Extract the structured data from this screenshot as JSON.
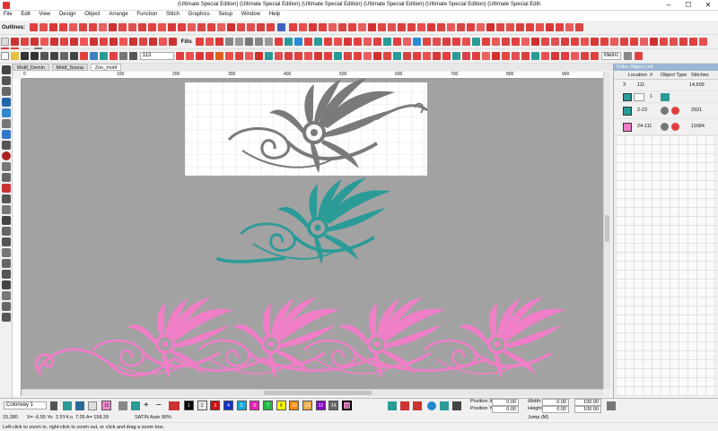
{
  "window": {
    "title": "(Ultimate Special Edition) (Ultimate Special Edition) (Ultimate Special Edition) (Ultimate Special Edition) (Ultimate Special Edition) (Ultimate Special Editi",
    "minimize": "–",
    "maximize": "☐",
    "close": "✕"
  },
  "menu": [
    "File",
    "Edit",
    "View",
    "Design",
    "Object",
    "Arrange",
    "Function",
    "Stitch",
    "Graphics",
    "Setup",
    "Window",
    "Help"
  ],
  "toolbar1": {
    "outlines_label": "Outlines:",
    "fills_label": "Fills",
    "threed_label": "3D"
  },
  "toolbar3": {
    "zoom_value": "113",
    "units_value": "Metric"
  },
  "tabs": [
    "Motif_Demin",
    "Motif_Sosna",
    "Zon_motif"
  ],
  "ruler": {
    "ticks": [
      "0",
      "100",
      "200",
      "300",
      "400",
      "500",
      "600",
      "700",
      "800",
      "900",
      "1000"
    ]
  },
  "panel": {
    "title": "Color Object List",
    "col_location": "Location",
    "col_num": "#",
    "col_object_type": "Object Type",
    "col_stitches": "Stitches",
    "rows": [
      {
        "color": "3",
        "num": "111",
        "type": "",
        "stitches": "14,605"
      },
      {
        "color": "",
        "num": "1",
        "type": "",
        "stitches": ""
      },
      {
        "color": "",
        "num": "2-23",
        "type": "",
        "stitches": "2921"
      },
      {
        "color": "",
        "num": "24-111",
        "type": "",
        "stitches": "11684"
      }
    ]
  },
  "bottom": {
    "colorway": "Colorway 1",
    "selected_color": "15",
    "swatches": [
      {
        "num": "1",
        "color": "#000000"
      },
      {
        "num": "2",
        "color": "#e8e8e8"
      },
      {
        "num": "3",
        "color": "#cc1111"
      },
      {
        "num": "4",
        "color": "#1133cc"
      },
      {
        "num": "5",
        "color": "#11aadd"
      },
      {
        "num": "6",
        "color": "#ee22bb"
      },
      {
        "num": "7",
        "color": "#22bb44"
      },
      {
        "num": "8",
        "color": "#ffff00"
      },
      {
        "num": "10",
        "color": "#ff8800"
      },
      {
        "num": "12",
        "color": "#eeaa44"
      },
      {
        "num": "13",
        "color": "#8800cc"
      },
      {
        "num": "14",
        "color": "#666666"
      },
      {
        "num": "15",
        "color": "#ee88cc"
      }
    ],
    "pos_x_label": "Position X:",
    "pos_x": "0.00",
    "pos_y_label": "Position Y:",
    "pos_y": "0.00",
    "width_label": "Width:",
    "width": "0.00",
    "height_label": "Height:",
    "height": "0.00",
    "pct1": "100.00",
    "pct2": "100.00"
  },
  "status": {
    "stitch_count": "15,380",
    "x": "X= -6.55 Yo",
    "y": "2.5Y4.o",
    "a": "7.05 A= 158.39",
    "mode": "SATIN Auto 90%",
    "jump": "Jump (M)"
  },
  "hint": "Left-click to zoom in, right-click to zoom out, or click and drag a zoom box.",
  "colors": {
    "teal": "#2a9b97",
    "pink": "#f07fc8",
    "gray_motif": "#7a7a7a",
    "canvas": "#a2a2a2"
  }
}
